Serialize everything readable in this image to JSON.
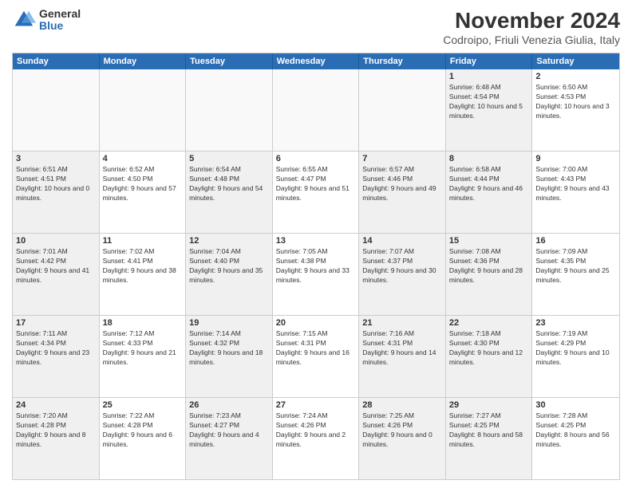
{
  "logo": {
    "general": "General",
    "blue": "Blue"
  },
  "title": "November 2024",
  "subtitle": "Codroipo, Friuli Venezia Giulia, Italy",
  "headers": [
    "Sunday",
    "Monday",
    "Tuesday",
    "Wednesday",
    "Thursday",
    "Friday",
    "Saturday"
  ],
  "rows": [
    [
      {
        "day": "",
        "info": "",
        "empty": true
      },
      {
        "day": "",
        "info": "",
        "empty": true
      },
      {
        "day": "",
        "info": "",
        "empty": true
      },
      {
        "day": "",
        "info": "",
        "empty": true
      },
      {
        "day": "",
        "info": "",
        "empty": true
      },
      {
        "day": "1",
        "info": "Sunrise: 6:48 AM\nSunset: 4:54 PM\nDaylight: 10 hours and 5 minutes.",
        "shaded": true
      },
      {
        "day": "2",
        "info": "Sunrise: 6:50 AM\nSunset: 4:53 PM\nDaylight: 10 hours and 3 minutes.",
        "shaded": false
      }
    ],
    [
      {
        "day": "3",
        "info": "Sunrise: 6:51 AM\nSunset: 4:51 PM\nDaylight: 10 hours and 0 minutes.",
        "shaded": true
      },
      {
        "day": "4",
        "info": "Sunrise: 6:52 AM\nSunset: 4:50 PM\nDaylight: 9 hours and 57 minutes.",
        "shaded": false
      },
      {
        "day": "5",
        "info": "Sunrise: 6:54 AM\nSunset: 4:48 PM\nDaylight: 9 hours and 54 minutes.",
        "shaded": true
      },
      {
        "day": "6",
        "info": "Sunrise: 6:55 AM\nSunset: 4:47 PM\nDaylight: 9 hours and 51 minutes.",
        "shaded": false
      },
      {
        "day": "7",
        "info": "Sunrise: 6:57 AM\nSunset: 4:46 PM\nDaylight: 9 hours and 49 minutes.",
        "shaded": true
      },
      {
        "day": "8",
        "info": "Sunrise: 6:58 AM\nSunset: 4:44 PM\nDaylight: 9 hours and 46 minutes.",
        "shaded": true
      },
      {
        "day": "9",
        "info": "Sunrise: 7:00 AM\nSunset: 4:43 PM\nDaylight: 9 hours and 43 minutes.",
        "shaded": false
      }
    ],
    [
      {
        "day": "10",
        "info": "Sunrise: 7:01 AM\nSunset: 4:42 PM\nDaylight: 9 hours and 41 minutes.",
        "shaded": true
      },
      {
        "day": "11",
        "info": "Sunrise: 7:02 AM\nSunset: 4:41 PM\nDaylight: 9 hours and 38 minutes.",
        "shaded": false
      },
      {
        "day": "12",
        "info": "Sunrise: 7:04 AM\nSunset: 4:40 PM\nDaylight: 9 hours and 35 minutes.",
        "shaded": true
      },
      {
        "day": "13",
        "info": "Sunrise: 7:05 AM\nSunset: 4:38 PM\nDaylight: 9 hours and 33 minutes.",
        "shaded": false
      },
      {
        "day": "14",
        "info": "Sunrise: 7:07 AM\nSunset: 4:37 PM\nDaylight: 9 hours and 30 minutes.",
        "shaded": true
      },
      {
        "day": "15",
        "info": "Sunrise: 7:08 AM\nSunset: 4:36 PM\nDaylight: 9 hours and 28 minutes.",
        "shaded": true
      },
      {
        "day": "16",
        "info": "Sunrise: 7:09 AM\nSunset: 4:35 PM\nDaylight: 9 hours and 25 minutes.",
        "shaded": false
      }
    ],
    [
      {
        "day": "17",
        "info": "Sunrise: 7:11 AM\nSunset: 4:34 PM\nDaylight: 9 hours and 23 minutes.",
        "shaded": true
      },
      {
        "day": "18",
        "info": "Sunrise: 7:12 AM\nSunset: 4:33 PM\nDaylight: 9 hours and 21 minutes.",
        "shaded": false
      },
      {
        "day": "19",
        "info": "Sunrise: 7:14 AM\nSunset: 4:32 PM\nDaylight: 9 hours and 18 minutes.",
        "shaded": true
      },
      {
        "day": "20",
        "info": "Sunrise: 7:15 AM\nSunset: 4:31 PM\nDaylight: 9 hours and 16 minutes.",
        "shaded": false
      },
      {
        "day": "21",
        "info": "Sunrise: 7:16 AM\nSunset: 4:31 PM\nDaylight: 9 hours and 14 minutes.",
        "shaded": true
      },
      {
        "day": "22",
        "info": "Sunrise: 7:18 AM\nSunset: 4:30 PM\nDaylight: 9 hours and 12 minutes.",
        "shaded": true
      },
      {
        "day": "23",
        "info": "Sunrise: 7:19 AM\nSunset: 4:29 PM\nDaylight: 9 hours and 10 minutes.",
        "shaded": false
      }
    ],
    [
      {
        "day": "24",
        "info": "Sunrise: 7:20 AM\nSunset: 4:28 PM\nDaylight: 9 hours and 8 minutes.",
        "shaded": true
      },
      {
        "day": "25",
        "info": "Sunrise: 7:22 AM\nSunset: 4:28 PM\nDaylight: 9 hours and 6 minutes.",
        "shaded": false
      },
      {
        "day": "26",
        "info": "Sunrise: 7:23 AM\nSunset: 4:27 PM\nDaylight: 9 hours and 4 minutes.",
        "shaded": true
      },
      {
        "day": "27",
        "info": "Sunrise: 7:24 AM\nSunset: 4:26 PM\nDaylight: 9 hours and 2 minutes.",
        "shaded": false
      },
      {
        "day": "28",
        "info": "Sunrise: 7:25 AM\nSunset: 4:26 PM\nDaylight: 9 hours and 0 minutes.",
        "shaded": true
      },
      {
        "day": "29",
        "info": "Sunrise: 7:27 AM\nSunset: 4:25 PM\nDaylight: 8 hours and 58 minutes.",
        "shaded": true
      },
      {
        "day": "30",
        "info": "Sunrise: 7:28 AM\nSunset: 4:25 PM\nDaylight: 8 hours and 56 minutes.",
        "shaded": false
      }
    ]
  ]
}
